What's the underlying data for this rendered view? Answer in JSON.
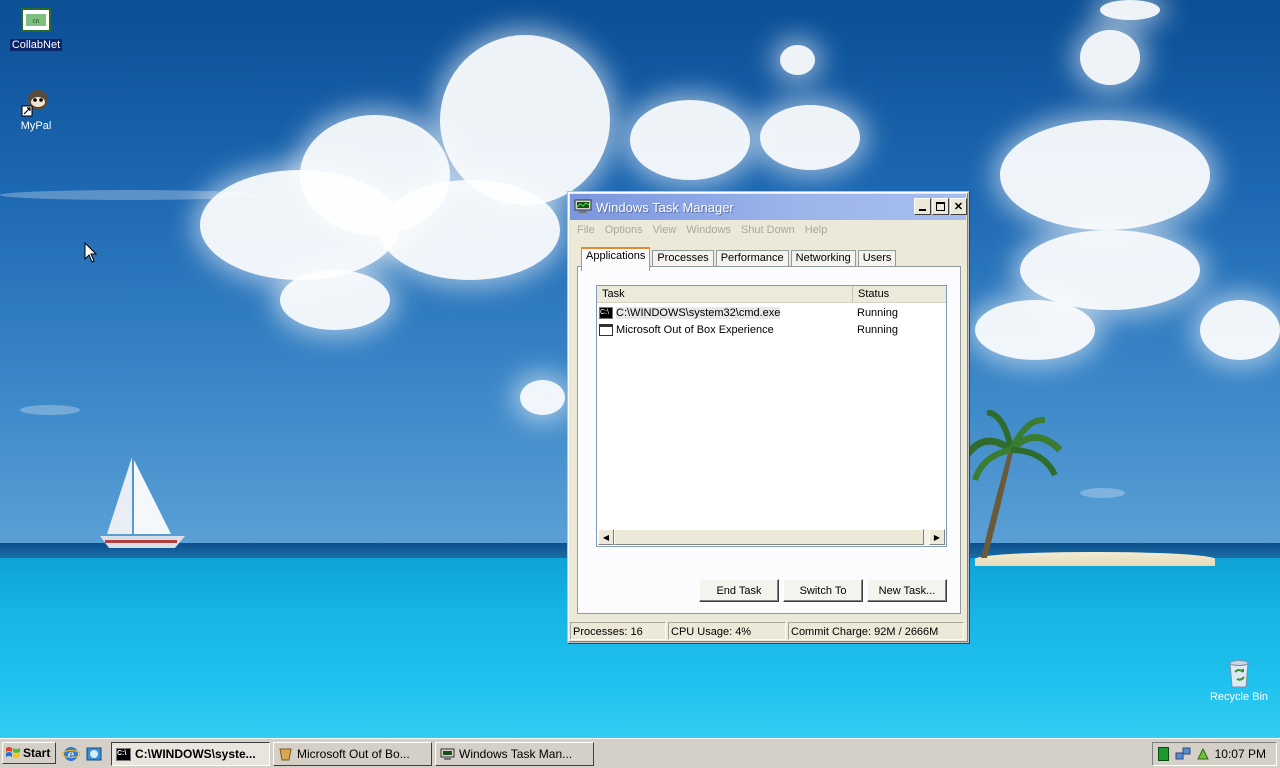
{
  "desktop": {
    "icons": [
      {
        "label": "CollabNet",
        "icon": "collabnet-icon"
      },
      {
        "label": "MyPal",
        "icon": "mypal-icon"
      },
      {
        "label": "Recycle Bin",
        "icon": "recycle-bin-icon"
      }
    ]
  },
  "task_manager": {
    "title": "Windows Task Manager",
    "menu": [
      "File",
      "Options",
      "View",
      "Windows",
      "Shut Down",
      "Help"
    ],
    "tabs": [
      "Applications",
      "Processes",
      "Performance",
      "Networking",
      "Users"
    ],
    "active_tab": "Applications",
    "columns": [
      "Task",
      "Status"
    ],
    "rows": [
      {
        "task": "C:\\WINDOWS\\system32\\cmd.exe",
        "status": "Running",
        "icon": "cmd-icon"
      },
      {
        "task": "Microsoft Out of Box Experience",
        "status": "Running",
        "icon": "window-icon"
      }
    ],
    "buttons": {
      "end_task": "End Task",
      "switch_to": "Switch To",
      "new_task": "New Task..."
    },
    "status": {
      "processes": "Processes: 16",
      "cpu": "CPU Usage: 4%",
      "commit": "Commit Charge: 92M / 2666M"
    }
  },
  "taskbar": {
    "start_label": "Start",
    "quick_launch": [
      "internet-explorer-icon",
      "windows-explorer-icon"
    ],
    "tasks": [
      {
        "label": "C:\\WINDOWS\\syste...",
        "icon": "cmd-icon",
        "active": true
      },
      {
        "label": "Microsoft Out of Bo...",
        "icon": "oobe-icon",
        "active": false
      },
      {
        "label": "Windows Task Man...",
        "icon": "task-manager-icon",
        "active": false
      }
    ],
    "tray_icons": [
      "cpu-meter-icon",
      "network-icon",
      "security-icon"
    ],
    "clock": "10:07 PM"
  },
  "colors": {
    "title_bar": "#9db6ea",
    "sea": "#17b4e6",
    "sky": "#1d68b2"
  }
}
